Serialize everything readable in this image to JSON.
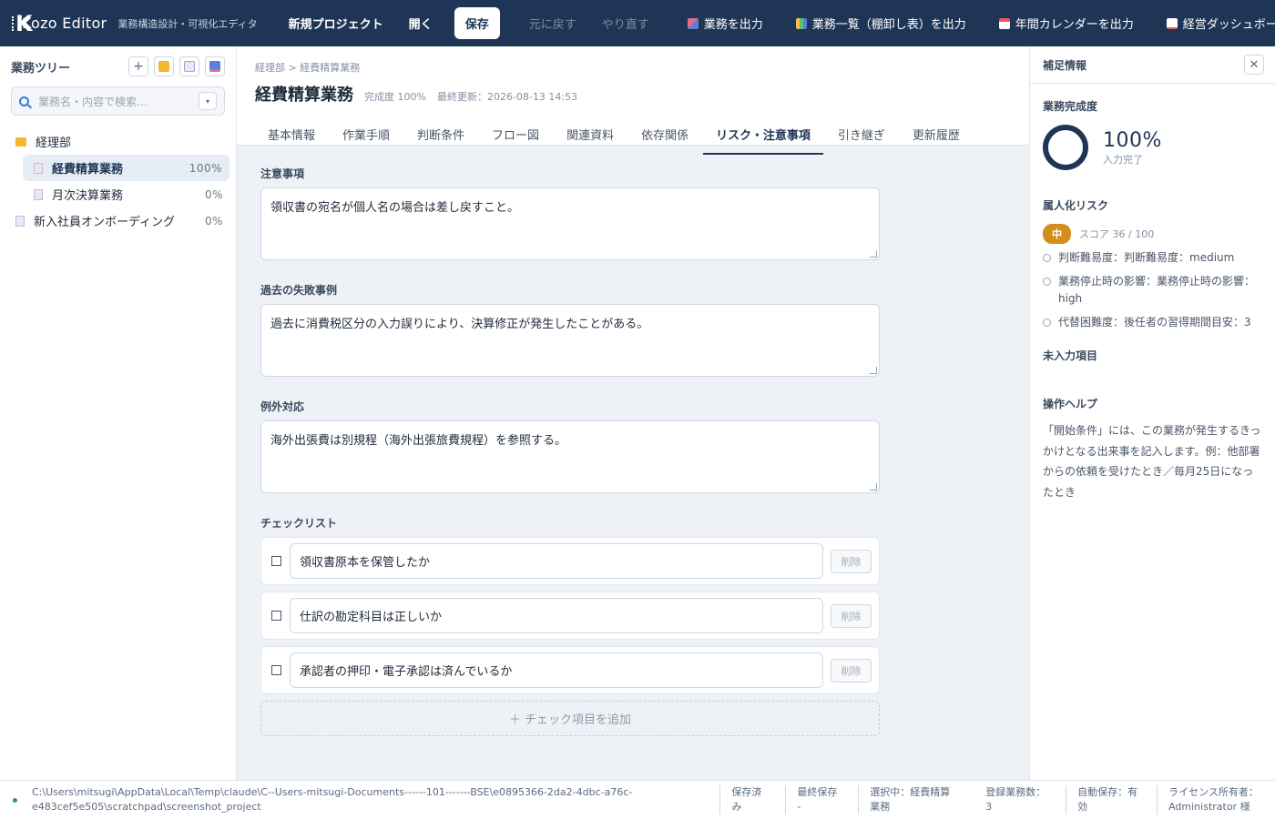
{
  "app": {
    "name": "Kozo Editor",
    "subtitle": "業務構造設計・可視化エディタ",
    "logo_letter": "K"
  },
  "toolbar": {
    "new_project": "新規プロジェクト",
    "open": "開く",
    "save": "保存",
    "undo": "元に戻す",
    "redo": "やり直す",
    "export_task": "業務を出力",
    "export_list": "業務一覧（棚卸し表）を出力",
    "export_calendar": "年間カレンダーを出力",
    "export_dashboard": "経営ダッシュボード"
  },
  "sidebar": {
    "title": "業務ツリー",
    "add_icon": "+",
    "search_placeholder": "業務名・内容で検索…",
    "dropdown_glyph": "▾",
    "tree": [
      {
        "label": "経理部",
        "pct": ""
      },
      {
        "label": "経費精算業務",
        "pct": "100%"
      },
      {
        "label": "月次決算業務",
        "pct": "0%"
      },
      {
        "label": "新入社員オンボーディング",
        "pct": "0%"
      }
    ]
  },
  "main": {
    "breadcrumb": "経理部 > 経費精算業務",
    "title": "経費精算業務",
    "completion": "完成度 100%",
    "last_updated": "最終更新：2026-08-13 14:53",
    "tabs": [
      "基本情報",
      "作業手順",
      "判断条件",
      "フロー図",
      "関連資料",
      "依存関係",
      "リスク・注意事項",
      "引き継ぎ",
      "更新履歴"
    ],
    "active_tab": "リスク・注意事項",
    "fields": {
      "caution_label": "注意事項",
      "caution_value": "領収書の宛名が個人名の場合は差し戻すこと。",
      "failures_label": "過去の失敗事例",
      "failures_value": "過去に消費税区分の入力誤りにより、決算修正が発生したことがある。",
      "exceptions_label": "例外対応",
      "exceptions_value": "海外出張費は別規程（海外出張旅費規程）を参照する。"
    },
    "checklist": {
      "label": "チェックリスト",
      "items": [
        "領収書原本を保管したか",
        "仕訳の勘定科目は正しいか",
        "承認者の押印・電子承認は済んでいるか"
      ],
      "delete_label": "削除",
      "add_label": "＋ チェック項目を追加"
    }
  },
  "rpanel": {
    "title": "補足情報",
    "close_glyph": "✕",
    "completion_label": "業務完成度",
    "completion_pct": "100%",
    "completion_value": 1.0,
    "completion_sub": "入力完了",
    "risk_label": "属人化リスク",
    "risk_badge": "中",
    "risk_score": "スコア 36 / 100",
    "risk_items": [
      "判断難易度：判断難易度：medium",
      "業務停止時の影響：業務停止時の影響：high",
      "代替困難度：後任者の習得期間目安：3"
    ],
    "missing_label": "未入力項目",
    "help_label": "操作ヘルプ",
    "help_text": "「開始条件」には、この業務が発生するきっかけとなる出来事を記入します。例：他部署からの依頼を受けたとき／毎月25日になったとき"
  },
  "statusbar": {
    "path": "C:\\Users\\mitsugi\\AppData\\Local\\Temp\\claude\\C--Users-mitsugi-Documents------101-------BSE\\e0895366-2da2-4dbc-a76c-e483cef5e505\\scratchpad\\screenshot_project",
    "saved": "保存済み",
    "last_saved": "最終保存 -",
    "selected": "選択中：経費精算業務",
    "count": "登録業務数：3",
    "autosave": "自動保存：有効",
    "license": "ライセンス所有者：Administrator 様"
  },
  "colors": {
    "topbar": "#1f3556",
    "accent": "#1f3556",
    "risk_badge": "#d48e1e",
    "status_ok": "#2e9e5b"
  }
}
